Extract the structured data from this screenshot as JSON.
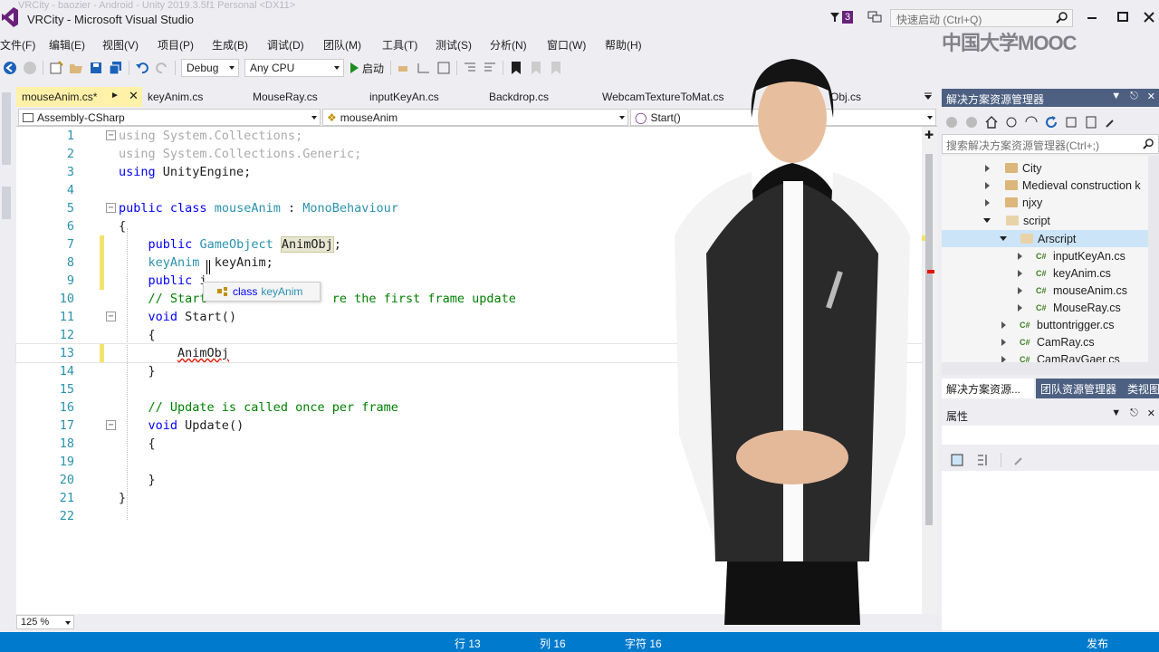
{
  "window": {
    "title": "VRCity - Microsoft Visual Studio",
    "background_title": "VRCity - baozier - Android - Unity 2019.3.5f1 Personal <DX11>",
    "notification_count": "3",
    "quick_launch_placeholder": "快速启动 (Ctrl+Q)",
    "watermark": "中国大学MOOC"
  },
  "menu": [
    "文件(F)",
    "编辑(E)",
    "视图(V)",
    "项目(P)",
    "生成(B)",
    "调试(D)",
    "团队(M)",
    "工具(T)",
    "测试(S)",
    "分析(N)",
    "窗口(W)",
    "帮助(H)"
  ],
  "toolbar": {
    "configuration": "Debug",
    "platform": "Any CPU",
    "start_label": "启动"
  },
  "tabs": [
    {
      "label": "mouseAnim.cs*",
      "active": true
    },
    {
      "label": "keyAnim.cs"
    },
    {
      "label": "MouseRay.cs"
    },
    {
      "label": "inputKeyAn.cs"
    },
    {
      "label": "Backdrop.cs"
    },
    {
      "label": "WebcamTextureToMat.cs"
    },
    {
      "label": "Obj.cs"
    }
  ],
  "navbar": {
    "project": "Assembly-CSharp",
    "type": "mouseAnim",
    "member": "Start()"
  },
  "code": {
    "line_numbers": [
      "1",
      "2",
      "3",
      "4",
      "5",
      "6",
      "7",
      "8",
      "9",
      "10",
      "11",
      "12",
      "13",
      "14",
      "15",
      "16",
      "17",
      "18",
      "19",
      "20",
      "21",
      "22"
    ],
    "l1": [
      "using",
      " System.Collections;"
    ],
    "l2": [
      "using",
      " System.Collections.Generic;"
    ],
    "l3": [
      "using",
      " UnityEngine;"
    ],
    "l5": [
      "public",
      "class",
      "mouseAnim",
      ":",
      "MonoBehaviour"
    ],
    "l6": "{",
    "l7": [
      "public",
      "GameObject",
      "AnimObj",
      ";"
    ],
    "l8": [
      "keyAnim",
      "keyAnim;"
    ],
    "l9": [
      "public",
      "i"
    ],
    "l10": [
      "// Start",
      "re the first frame update"
    ],
    "l11": [
      "void",
      "Start()"
    ],
    "l12": "{",
    "l13": "AnimObj",
    "l14": "}",
    "l16": "// Update is called once per frame",
    "l17": [
      "void",
      "Update()"
    ],
    "l18": "{",
    "l20": "}",
    "l21": "}"
  },
  "intellisense": {
    "kind": "class",
    "name": "keyAnim"
  },
  "zoom": "125 %",
  "solution_explorer": {
    "title": "解决方案资源管理器",
    "search_placeholder": "搜索解决方案资源管理器(Ctrl+;)",
    "items": [
      {
        "label": "City",
        "type": "folder",
        "expanded": false
      },
      {
        "label": "Medieval construction k",
        "type": "folder",
        "expanded": false
      },
      {
        "label": "njxy",
        "type": "folder",
        "expanded": false
      },
      {
        "label": "script",
        "type": "folder",
        "expanded": true
      },
      {
        "label": "Arscript",
        "type": "folder",
        "expanded": true,
        "selected": true
      },
      {
        "label": "inputKeyAn.cs",
        "type": "cs"
      },
      {
        "label": "keyAnim.cs",
        "type": "cs"
      },
      {
        "label": "mouseAnim.cs",
        "type": "cs"
      },
      {
        "label": "MouseRay.cs",
        "type": "cs"
      },
      {
        "label": "buttontrigger.cs",
        "type": "cs"
      },
      {
        "label": "CamRay.cs",
        "type": "cs"
      },
      {
        "label": "CamRayGaer.cs",
        "type": "cs"
      }
    ]
  },
  "panel_tabs": [
    "解决方案资源...",
    "团队资源管理器",
    "类视图"
  ],
  "properties_title": "属性",
  "status": {
    "line": "行 13",
    "col": "列 16",
    "char": "字符 16",
    "publish": "发布"
  },
  "colors": {
    "accent": "#007acc",
    "panel_title": "#4d6082",
    "active_tab": "#fff1a7",
    "keyword": "#0000ff",
    "type": "#2b91af",
    "comment": "#008000"
  }
}
